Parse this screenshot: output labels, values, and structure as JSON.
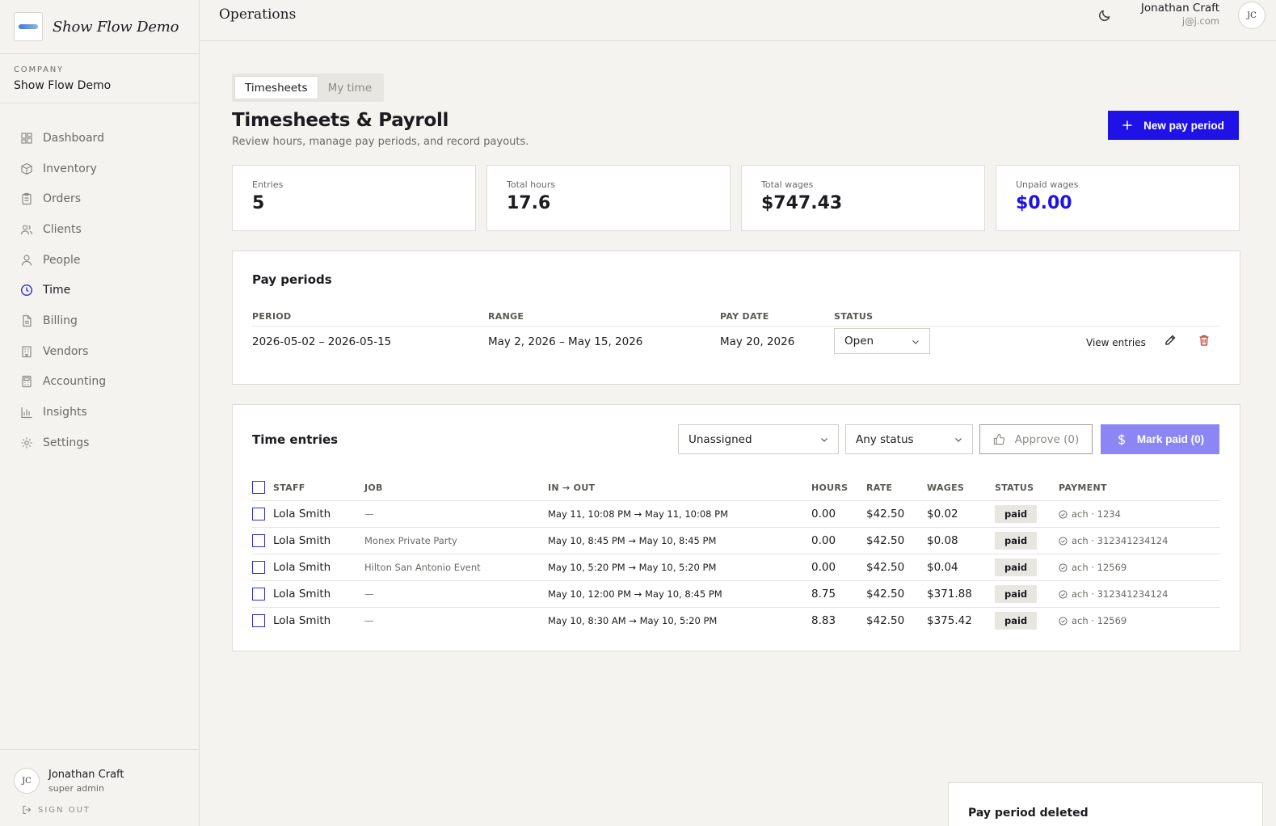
{
  "brand": {
    "name": "Show Flow Demo"
  },
  "company": {
    "label": "COMPANY",
    "name": "Show Flow Demo"
  },
  "nav": [
    {
      "label": "Dashboard",
      "icon": "dashboard-icon",
      "active": false
    },
    {
      "label": "Inventory",
      "icon": "box-icon",
      "active": false
    },
    {
      "label": "Orders",
      "icon": "clipboard-icon",
      "active": false
    },
    {
      "label": "Clients",
      "icon": "users-icon",
      "active": false
    },
    {
      "label": "People",
      "icon": "user-icon",
      "active": false
    },
    {
      "label": "Time",
      "icon": "clock-icon",
      "active": true
    },
    {
      "label": "Billing",
      "icon": "file-icon",
      "active": false
    },
    {
      "label": "Vendors",
      "icon": "building-icon",
      "active": false
    },
    {
      "label": "Accounting",
      "icon": "calculator-icon",
      "active": false
    },
    {
      "label": "Insights",
      "icon": "bar-chart-icon",
      "active": false
    },
    {
      "label": "Settings",
      "icon": "gear-icon",
      "active": false
    }
  ],
  "sidebar_user": {
    "initials": "JC",
    "name": "Jonathan Craft",
    "role": "super admin",
    "signout": "SIGN OUT"
  },
  "topbar": {
    "title": "Operations",
    "user_name": "Jonathan Craft",
    "user_email": "j@j.com",
    "initials": "JC"
  },
  "tabs": [
    {
      "label": "Timesheets",
      "active": true
    },
    {
      "label": "My time",
      "active": false
    }
  ],
  "page": {
    "title": "Timesheets & Payroll",
    "subtitle": "Review hours, manage pay periods, and record payouts.",
    "new_button": "New pay period"
  },
  "stats": [
    {
      "label": "Entries",
      "value": "5",
      "accent": false
    },
    {
      "label": "Total hours",
      "value": "17.6",
      "accent": false
    },
    {
      "label": "Total wages",
      "value": "$747.43",
      "accent": false
    },
    {
      "label": "Unpaid wages",
      "value": "$0.00",
      "accent": true
    }
  ],
  "pay_periods": {
    "title": "Pay periods",
    "columns": {
      "period": "PERIOD",
      "range": "RANGE",
      "pay_date": "PAY DATE",
      "status": "STATUS"
    },
    "rows": [
      {
        "period": "2026-05-02 – 2026-05-15",
        "range": "May 2, 2026 – May 15, 2026",
        "pay_date": "May 20, 2026",
        "status": "Open",
        "view": "View entries"
      }
    ]
  },
  "time_entries": {
    "title": "Time entries",
    "filter_staff": "Unassigned",
    "filter_status": "Any status",
    "approve": "Approve (0)",
    "mark_paid": "Mark paid (0)",
    "columns": {
      "staff": "STAFF",
      "job": "JOB",
      "inout": "IN → OUT",
      "hours": "HOURS",
      "rate": "RATE",
      "wages": "WAGES",
      "status": "STATUS",
      "payment": "PAYMENT"
    },
    "rows": [
      {
        "staff": "Lola Smith",
        "job": "—",
        "inout": "May 11, 10:08 PM → May 11, 10:08 PM",
        "hours": "0.00",
        "rate": "$42.50",
        "wages": "$0.02",
        "status": "paid",
        "payment": "ach · 1234"
      },
      {
        "staff": "Lola Smith",
        "job": "Monex Private Party",
        "inout": "May 10, 8:45 PM → May 10, 8:45 PM",
        "hours": "0.00",
        "rate": "$42.50",
        "wages": "$0.08",
        "status": "paid",
        "payment": "ach · 312341234124"
      },
      {
        "staff": "Lola Smith",
        "job": "Hilton San Antonio Event",
        "inout": "May 10, 5:20 PM → May 10, 5:20 PM",
        "hours": "0.00",
        "rate": "$42.50",
        "wages": "$0.04",
        "status": "paid",
        "payment": "ach · 12569"
      },
      {
        "staff": "Lola Smith",
        "job": "—",
        "inout": "May 10, 12:00 PM → May 10, 8:45 PM",
        "hours": "8.75",
        "rate": "$42.50",
        "wages": "$371.88",
        "status": "paid",
        "payment": "ach · 312341234124"
      },
      {
        "staff": "Lola Smith",
        "job": "—",
        "inout": "May 10, 8:30 AM → May 10, 5:20 PM",
        "hours": "8.83",
        "rate": "$42.50",
        "wages": "$375.42",
        "status": "paid",
        "payment": "ach · 12569"
      }
    ]
  },
  "toast": {
    "message": "Pay period deleted"
  },
  "colors": {
    "accent": "#1e12e6",
    "accent_light": "#8b86f3",
    "background": "#f4f3ef"
  }
}
